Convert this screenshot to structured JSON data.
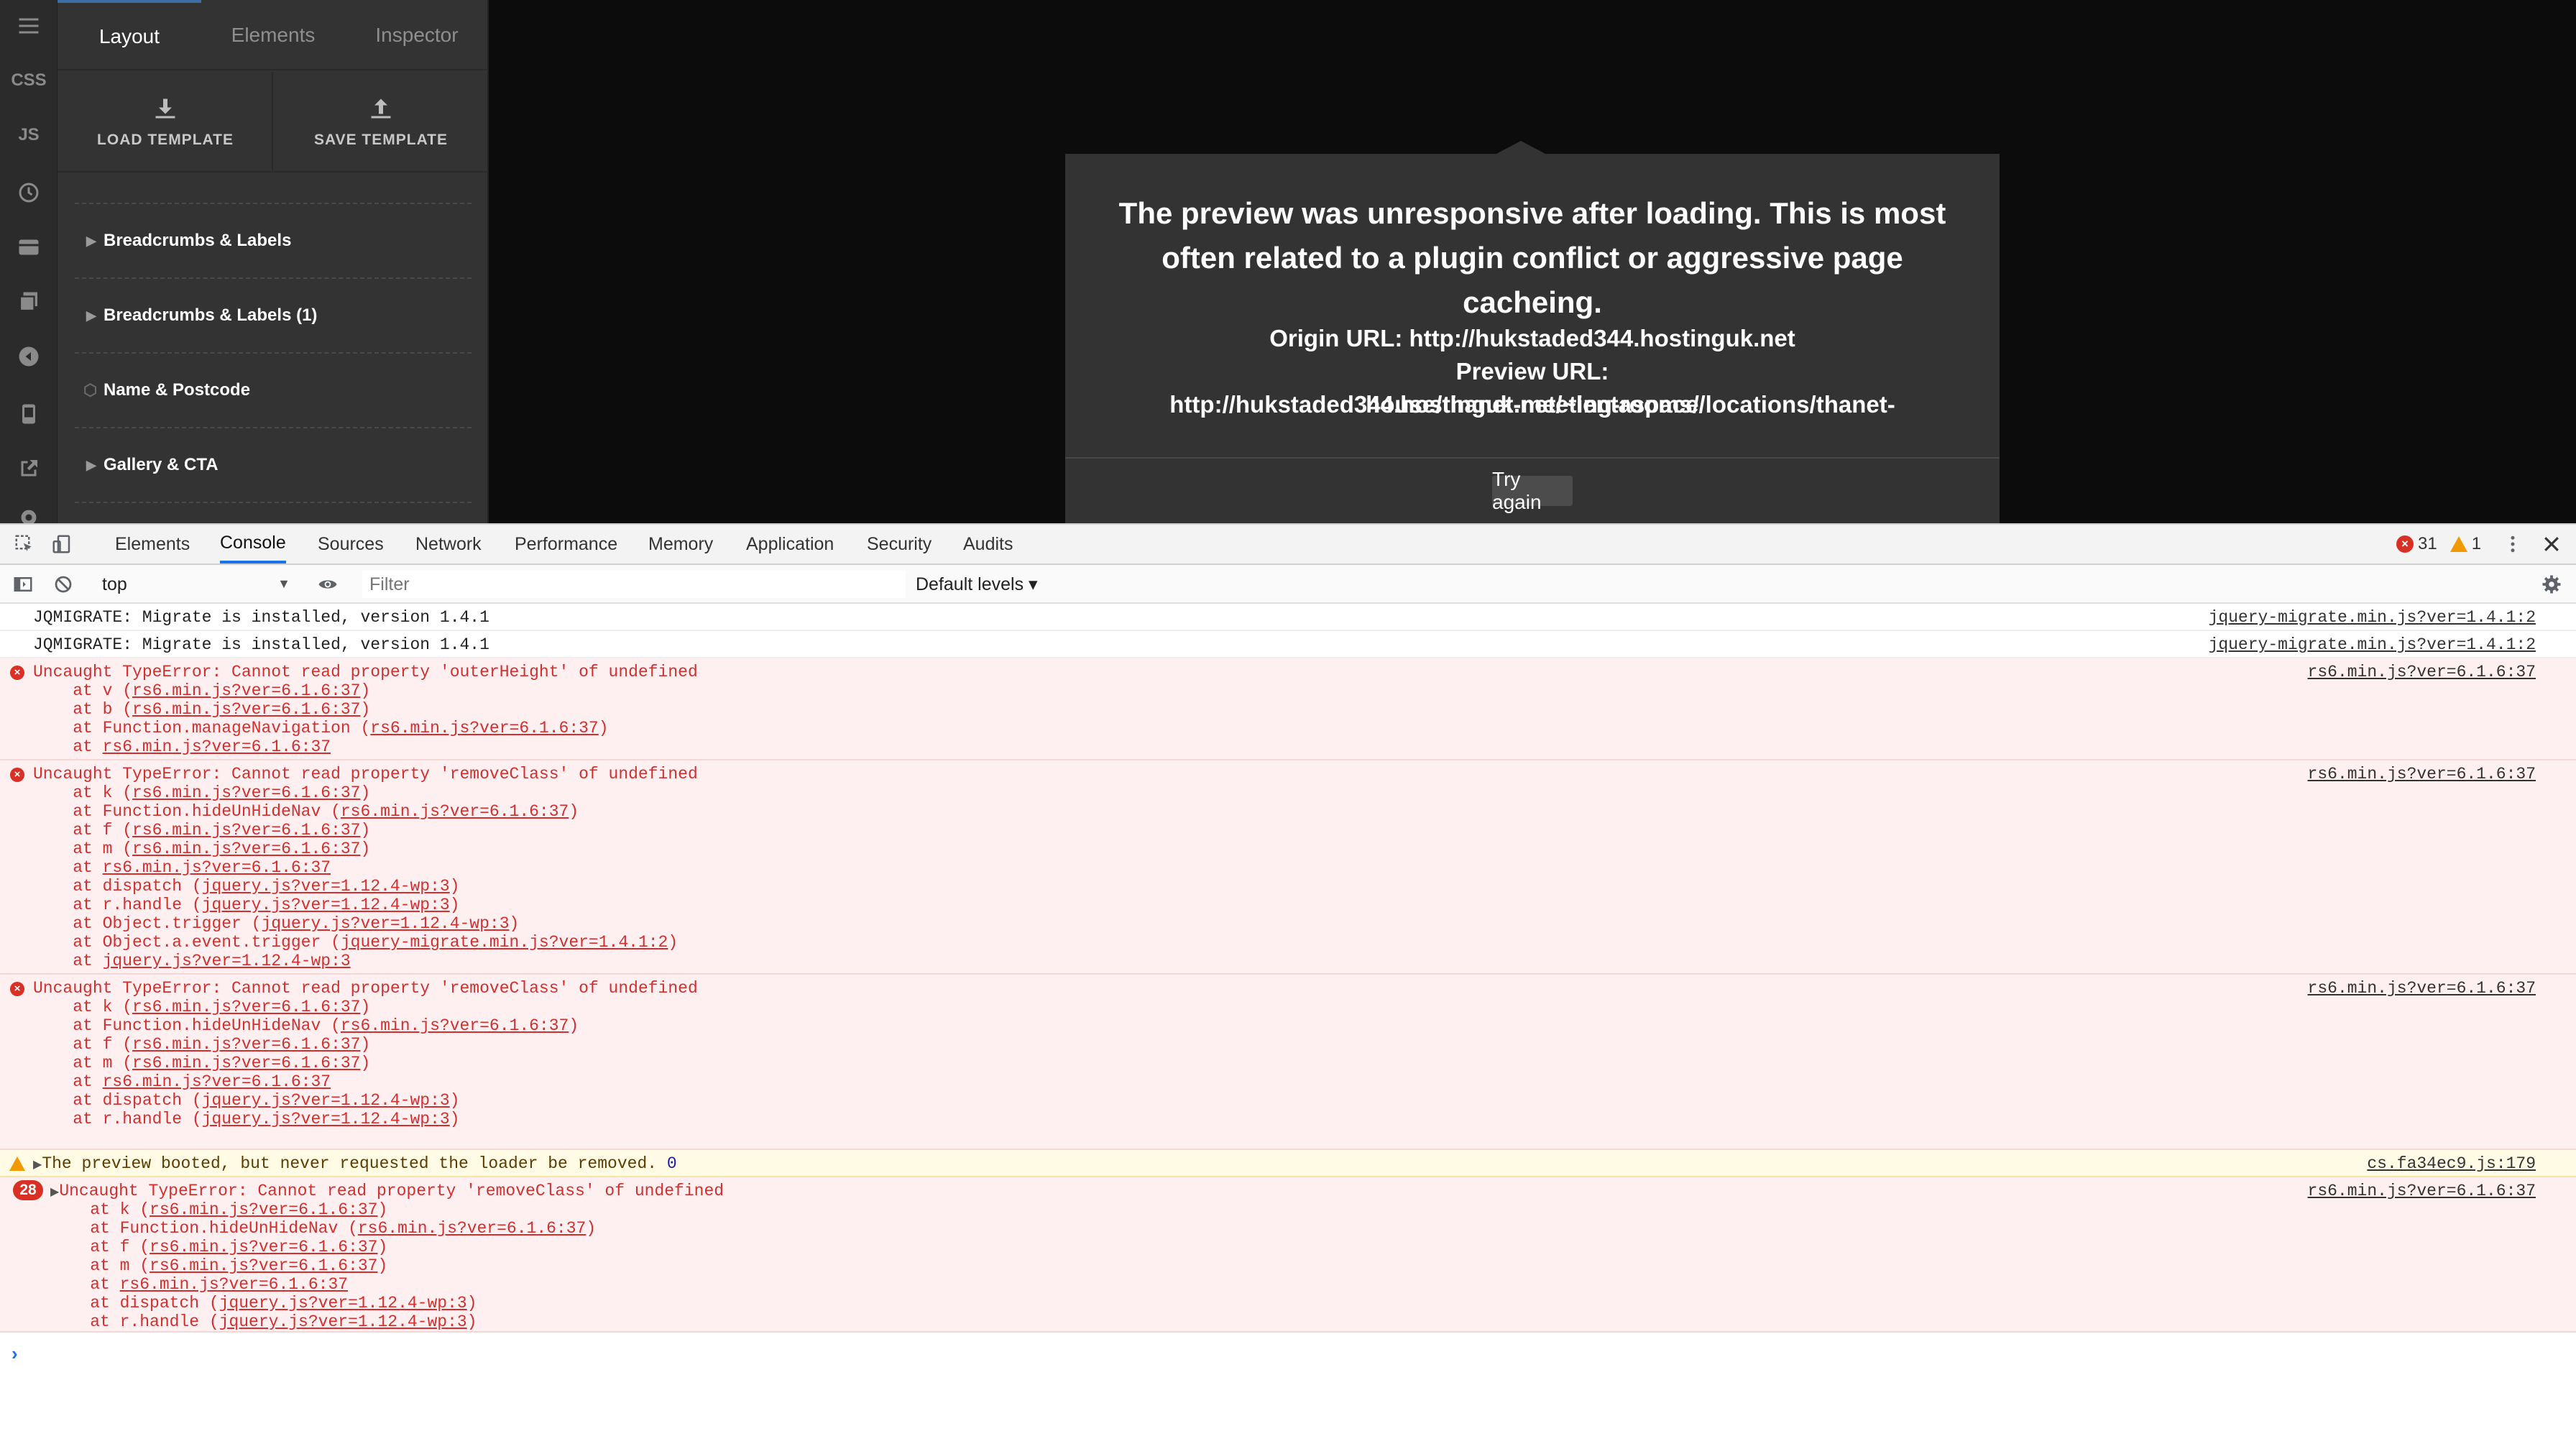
{
  "panel": {
    "tabs": [
      "Layout",
      "Elements",
      "Inspector"
    ],
    "load_template": "LOAD TEMPLATE",
    "save_template": "SAVE TEMPLATE",
    "items": [
      "Breadcrumbs & Labels",
      "Breadcrumbs & Labels (1)",
      "Name & Postcode",
      "Gallery & CTA"
    ]
  },
  "iconbar": {
    "css": "CSS",
    "js": "JS"
  },
  "modal": {
    "message": "The preview was unresponsive after loading. This is most often related to a plugin conflict or aggressive page cacheing.",
    "origin": "Origin URL: http://hukstaded344.hostinguk.net",
    "preview_line1": "Preview URL: http://hukstaded344.hostinguk.net/~lentaspace/locations/thanet-",
    "preview_line2": "house/thanet-meeting-rooms/",
    "try_again": "Try again"
  },
  "devtools": {
    "tabs": [
      "Elements",
      "Console",
      "Sources",
      "Network",
      "Performance",
      "Memory",
      "Application",
      "Security",
      "Audits"
    ],
    "error_count": "31",
    "warning_count": "1",
    "context": "top",
    "filter_placeholder": "Filter",
    "levels": "Default levels ▾"
  },
  "console": {
    "rows": [
      {
        "msg": "JQMIGRATE: Migrate is installed, version 1.4.1",
        "src": "jquery-migrate.min.js?ver=1.4.1:2"
      },
      {
        "msg": "JQMIGRATE: Migrate is installed, version 1.4.1",
        "src": "jquery-migrate.min.js?ver=1.4.1:2"
      },
      {
        "msg": "Uncaught TypeError: Cannot read property 'outerHeight' of undefined",
        "src": "rs6.min.js?ver=6.1.6:37"
      },
      {
        "msg": "Uncaught TypeError: Cannot read property 'removeClass' of undefined",
        "src": "rs6.min.js?ver=6.1.6:37"
      },
      {
        "msg": "Uncaught TypeError: Cannot read property 'removeClass' of undefined",
        "src": "rs6.min.js?ver=6.1.6:37"
      },
      {
        "msg": "The preview booted, but never requested the loader be removed.",
        "num": "0",
        "src": "cs.fa34ec9.js:179"
      },
      {
        "msg": "Uncaught TypeError: Cannot read property 'removeClass' of undefined",
        "count": "28",
        "src": "rs6.min.js?ver=6.1.6:37"
      }
    ],
    "stack1": [
      [
        "    at v (",
        "rs6.min.js?ver=6.1.6:37",
        ")"
      ],
      [
        "    at b (",
        "rs6.min.js?ver=6.1.6:37",
        ")"
      ],
      [
        "    at Function.manageNavigation (",
        "rs6.min.js?ver=6.1.6:37",
        ")"
      ],
      [
        "    at ",
        "rs6.min.js?ver=6.1.6:37",
        ""
      ]
    ],
    "stack2": [
      [
        "    at k (",
        "rs6.min.js?ver=6.1.6:37",
        ")"
      ],
      [
        "    at Function.hideUnHideNav (",
        "rs6.min.js?ver=6.1.6:37",
        ")"
      ],
      [
        "    at f (",
        "rs6.min.js?ver=6.1.6:37",
        ")"
      ],
      [
        "    at m (",
        "rs6.min.js?ver=6.1.6:37",
        ")"
      ],
      [
        "    at ",
        "rs6.min.js?ver=6.1.6:37",
        ""
      ],
      [
        "    at dispatch (",
        "jquery.js?ver=1.12.4-wp:3",
        ")"
      ],
      [
        "    at r.handle (",
        "jquery.js?ver=1.12.4-wp:3",
        ")"
      ],
      [
        "    at Object.trigger (",
        "jquery.js?ver=1.12.4-wp:3",
        ")"
      ],
      [
        "    at Object.a.event.trigger (",
        "jquery-migrate.min.js?ver=1.4.1:2",
        ")"
      ],
      [
        "    at ",
        "jquery.js?ver=1.12.4-wp:3",
        ""
      ]
    ],
    "stack3": [
      [
        "    at k (",
        "rs6.min.js?ver=6.1.6:37",
        ")"
      ],
      [
        "    at Function.hideUnHideNav (",
        "rs6.min.js?ver=6.1.6:37",
        ")"
      ],
      [
        "    at f (",
        "rs6.min.js?ver=6.1.6:37",
        ")"
      ],
      [
        "    at m (",
        "rs6.min.js?ver=6.1.6:37",
        ")"
      ],
      [
        "    at ",
        "rs6.min.js?ver=6.1.6:37",
        ""
      ],
      [
        "    at dispatch (",
        "jquery.js?ver=1.12.4-wp:3",
        ")"
      ],
      [
        "    at r.handle (",
        "jquery.js?ver=1.12.4-wp:3",
        ")"
      ]
    ],
    "stack4": [
      [
        "    at k (",
        "rs6.min.js?ver=6.1.6:37",
        ")"
      ],
      [
        "    at Function.hideUnHideNav (",
        "rs6.min.js?ver=6.1.6:37",
        ")"
      ],
      [
        "    at f (",
        "rs6.min.js?ver=6.1.6:37",
        ")"
      ],
      [
        "    at m (",
        "rs6.min.js?ver=6.1.6:37",
        ")"
      ],
      [
        "    at ",
        "rs6.min.js?ver=6.1.6:37",
        ""
      ],
      [
        "    at dispatch (",
        "jquery.js?ver=1.12.4-wp:3",
        ")"
      ],
      [
        "    at r.handle (",
        "jquery.js?ver=1.12.4-wp:3",
        ")"
      ]
    ],
    "prompt": "›"
  },
  "colors": {
    "accent": "#1a73e8",
    "error": "#d93025",
    "warning": "#f29900",
    "panel": "#333333"
  }
}
